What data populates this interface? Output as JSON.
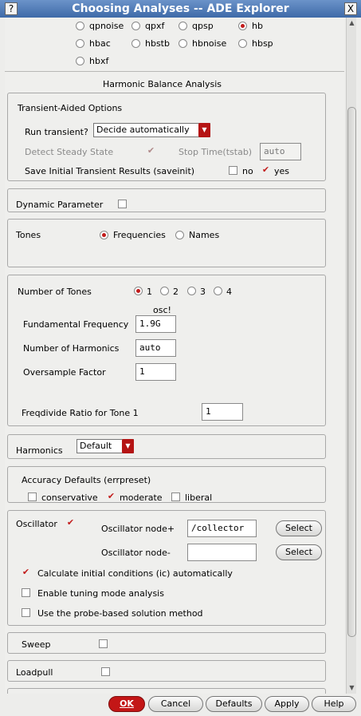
{
  "window": {
    "title": "Choosing Analyses -- ADE Explorer",
    "help_icon": "?",
    "close_icon": "X"
  },
  "analysis_types": [
    {
      "label": "qpnoise",
      "selected": false
    },
    {
      "label": "qpxf",
      "selected": false
    },
    {
      "label": "qpsp",
      "selected": false
    },
    {
      "label": "hb",
      "selected": true
    },
    {
      "label": "hbac",
      "selected": false
    },
    {
      "label": "hbstb",
      "selected": false
    },
    {
      "label": "hbnoise",
      "selected": false
    },
    {
      "label": "hbsp",
      "selected": false
    },
    {
      "label": "hbxf",
      "selected": false
    }
  ],
  "section_title": "Harmonic Balance Analysis",
  "transient": {
    "title": "Transient-Aided Options",
    "run_label": "Run transient?",
    "run_value": "Decide automatically",
    "detect_label": "Detect Steady State",
    "stop_label": "Stop Time(tstab)",
    "stop_value": "auto",
    "save_label": "Save Initial Transient Results (saveinit)",
    "no_label": "no",
    "yes_label": "yes"
  },
  "dynamic": {
    "label": "Dynamic Parameter"
  },
  "tones": {
    "label": "Tones",
    "freq_label": "Frequencies",
    "names_label": "Names"
  },
  "ntones": {
    "label": "Number of Tones",
    "options": [
      "1",
      "2",
      "3",
      "4"
    ],
    "column_header": "osc!",
    "fund_label": "Fundamental Frequency",
    "fund_value": "1.9G",
    "harm_label": "Number of Harmonics",
    "harm_value": "auto",
    "over_label": "Oversample Factor",
    "over_value": "1",
    "freqdiv_label": "Freqdivide Ratio for Tone 1",
    "freqdiv_value": "1"
  },
  "harmonics": {
    "label": "Harmonics",
    "value": "Default"
  },
  "accuracy": {
    "title": "Accuracy Defaults (errpreset)",
    "conservative": "conservative",
    "moderate": "moderate",
    "liberal": "liberal"
  },
  "oscillator": {
    "label": "Oscillator",
    "node_plus_label": "Oscillator node+",
    "node_plus_value": "/collector",
    "node_minus_label": "Oscillator node-",
    "node_minus_value": "",
    "select_label": "Select",
    "calc_ic_label": "Calculate initial conditions (ic) automatically",
    "tuning_label": "Enable tuning mode analysis",
    "probe_label": "Use the probe-based solution method"
  },
  "sweep": {
    "label": "Sweep"
  },
  "loadpull": {
    "label": "Loadpull"
  },
  "footer": {
    "ok": "OK",
    "cancel": "Cancel",
    "defaults": "Defaults",
    "apply": "Apply",
    "help": "Help"
  },
  "colors": {
    "accent": "#c21b1b",
    "titlebar": "#4a75b3"
  }
}
